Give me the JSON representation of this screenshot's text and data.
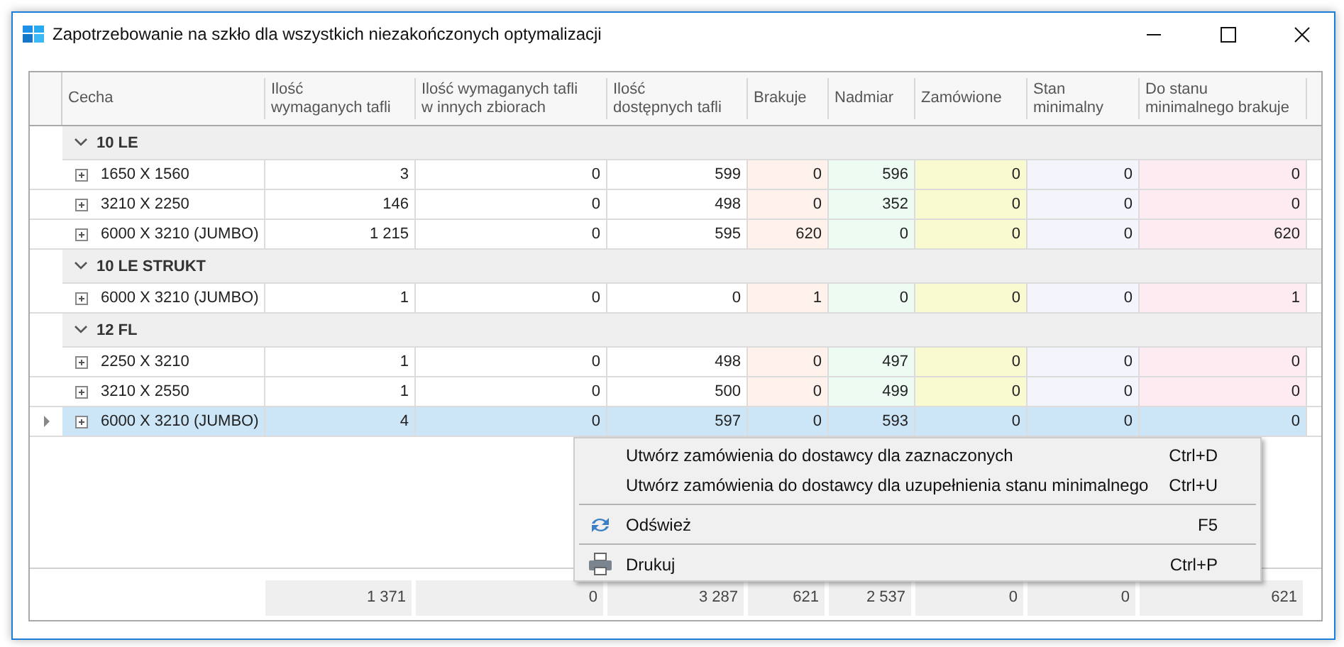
{
  "window": {
    "title": "Zapotrzebowanie na szkło dla wszystkich niezakończonych optymalizacji"
  },
  "table": {
    "columns": [
      {
        "lines": [
          "Cecha"
        ]
      },
      {
        "lines": [
          "Ilość",
          "wymaganych tafli"
        ]
      },
      {
        "lines": [
          "Ilość wymaganych tafli",
          "w innych zbiorach"
        ]
      },
      {
        "lines": [
          "Ilość",
          "dostępnych tafli"
        ]
      },
      {
        "lines": [
          "Brakuje"
        ],
        "color": "#fff1ec"
      },
      {
        "lines": [
          "Nadmiar"
        ],
        "color": "#eefbf3"
      },
      {
        "lines": [
          "Zamówione"
        ],
        "color": "#fafad0"
      },
      {
        "lines": [
          "Stan",
          "minimalny"
        ],
        "color": "#f4f5fc"
      },
      {
        "lines": [
          "Do stanu",
          "minimalnego brakuje"
        ],
        "color": "#fdebf1"
      }
    ],
    "groups": [
      {
        "label": "10 LE",
        "expanded": true,
        "rows": [
          {
            "cells": [
              "1650 X 1560",
              "3",
              "0",
              "599",
              "0",
              "596",
              "0",
              "0",
              "0"
            ],
            "selected": false
          },
          {
            "cells": [
              "3210 X 2250",
              "146",
              "0",
              "498",
              "0",
              "352",
              "0",
              "0",
              "0"
            ],
            "selected": false
          },
          {
            "cells": [
              "6000 X 3210 (JUMBO)",
              "1 215",
              "0",
              "595",
              "620",
              "0",
              "0",
              "0",
              "620"
            ],
            "selected": false
          }
        ]
      },
      {
        "label": "10 LE STRUKT",
        "expanded": true,
        "rows": [
          {
            "cells": [
              "6000 X 3210 (JUMBO)",
              "1",
              "0",
              "0",
              "1",
              "0",
              "0",
              "0",
              "1"
            ],
            "selected": false
          }
        ]
      },
      {
        "label": "12 FL",
        "expanded": true,
        "rows": [
          {
            "cells": [
              "2250 X 3210",
              "1",
              "0",
              "498",
              "0",
              "497",
              "0",
              "0",
              "0"
            ],
            "selected": false
          },
          {
            "cells": [
              "3210 X 2550",
              "1",
              "0",
              "500",
              "0",
              "499",
              "0",
              "0",
              "0"
            ],
            "selected": false
          },
          {
            "cells": [
              "6000 X 3210 (JUMBO)",
              "4",
              "0",
              "597",
              "0",
              "593",
              "0",
              "0",
              "0"
            ],
            "selected": true
          }
        ]
      }
    ],
    "totals": [
      "1 371",
      "0",
      "3 287",
      "621",
      "2 537",
      "0",
      "0",
      "621"
    ]
  },
  "context_menu": {
    "items": [
      {
        "kind": "item",
        "label": "Utwórz zamówienia do dostawcy dla zaznaczonych",
        "shortcut": "Ctrl+D"
      },
      {
        "kind": "item",
        "label": "Utwórz zamówienia do dostawcy dla uzupełnienia stanu minimalnego",
        "shortcut": "Ctrl+U"
      },
      {
        "kind": "separator"
      },
      {
        "kind": "refresh",
        "label": "Odśwież",
        "shortcut": "F5"
      },
      {
        "kind": "separator"
      },
      {
        "kind": "print",
        "label": "Drukuj",
        "shortcut": "Ctrl+P"
      }
    ]
  }
}
